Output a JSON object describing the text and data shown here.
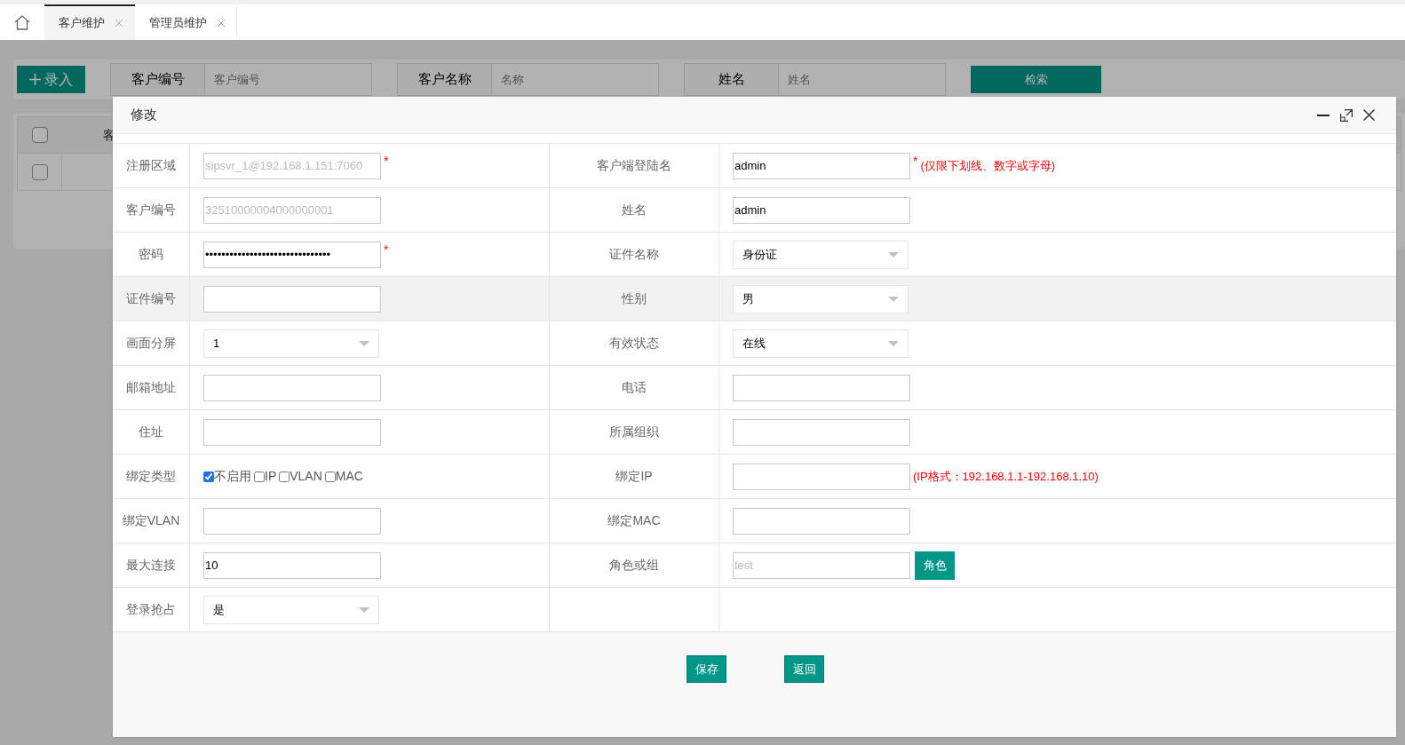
{
  "tabs": [
    {
      "label": "客户维护",
      "selected": true
    },
    {
      "label": "管理员维护",
      "selected": false
    }
  ],
  "add_button": "录入",
  "search_fields": [
    {
      "label": "客户编号",
      "placeholder": "客户编号"
    },
    {
      "label": "客户名称",
      "placeholder": "名称"
    },
    {
      "label": "姓名",
      "placeholder": "姓名"
    }
  ],
  "search_button": "检索",
  "table": {
    "header_checked": false,
    "column_1": "客",
    "rows": [
      {
        "checked": false
      }
    ]
  },
  "dialog": {
    "title": "修改",
    "rows": [
      {
        "highlighted": false,
        "left": {
          "label": "注册区域",
          "kind": "text",
          "value": "sipsvr_1@192.168.1.151:7060",
          "disabled": true,
          "marker": "*"
        },
        "right": {
          "label": "客户端登陆名",
          "kind": "text",
          "value": "admin",
          "marker": "*",
          "hint": "(仅限下划线、数字或字母)"
        }
      },
      {
        "highlighted": false,
        "left": {
          "label": "客户编号",
          "kind": "text",
          "value": "32510000004000000001",
          "disabled": true
        },
        "right": {
          "label": "姓名",
          "kind": "text",
          "value": "admin"
        }
      },
      {
        "highlighted": false,
        "left": {
          "label": "密码",
          "kind": "text",
          "value": "•••••••••••••••••••••••••••••••",
          "marker": "*"
        },
        "right": {
          "label": "证件名称",
          "kind": "select",
          "value": "身份证"
        }
      },
      {
        "highlighted": true,
        "left": {
          "label": "证件编号",
          "kind": "text"
        },
        "right": {
          "label": "性别",
          "kind": "select",
          "value": "男"
        }
      },
      {
        "highlighted": false,
        "left": {
          "label": "画面分屏",
          "kind": "select",
          "value": "1"
        },
        "right": {
          "label": "有效状态",
          "kind": "select",
          "value": "在线"
        }
      },
      {
        "highlighted": false,
        "left": {
          "label": "邮箱地址",
          "kind": "text"
        },
        "right": {
          "label": "电话",
          "kind": "text"
        }
      },
      {
        "highlighted": false,
        "left": {
          "label": "住址",
          "kind": "text"
        },
        "right": {
          "label": "所属组织",
          "kind": "text"
        }
      },
      {
        "highlighted": false,
        "left": {
          "label": "绑定类型",
          "kind": "checkboxes",
          "options": [
            {
              "label": "不启用",
              "checked": true
            },
            {
              "label": "IP",
              "checked": false
            },
            {
              "label": "VLAN",
              "checked": false
            },
            {
              "label": "MAC",
              "checked": false
            }
          ]
        },
        "right": {
          "label": "绑定IP",
          "kind": "text",
          "hint": "(IP格式：192.168.1.1-192.168.1.10)"
        }
      },
      {
        "highlighted": false,
        "left": {
          "label": "绑定VLAN",
          "kind": "text"
        },
        "right": {
          "label": "绑定MAC",
          "kind": "text"
        }
      },
      {
        "highlighted": false,
        "left": {
          "label": "最大连接",
          "kind": "text",
          "value": "10"
        },
        "right": {
          "label": "角色或组",
          "kind": "role",
          "value": "test",
          "disabled": true,
          "button": "角色"
        }
      },
      {
        "highlighted": false,
        "left": {
          "label": "登录抢占",
          "kind": "select",
          "value": "是"
        }
      }
    ],
    "buttons": [
      "保存",
      "返回"
    ]
  }
}
